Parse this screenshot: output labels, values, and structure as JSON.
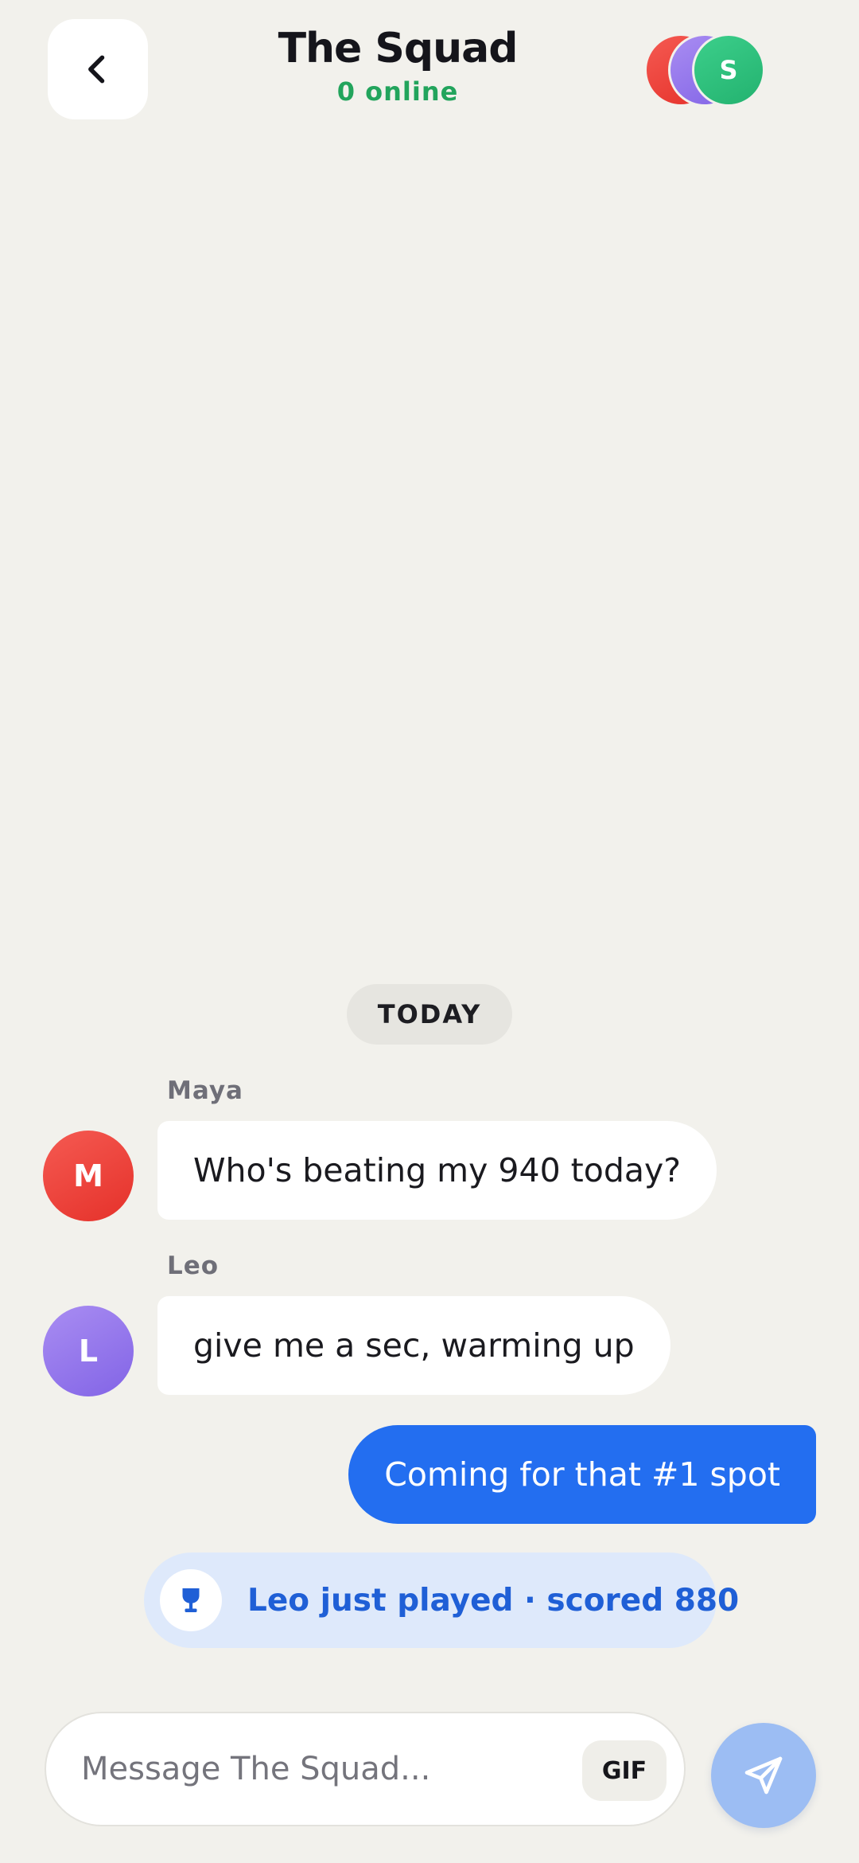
{
  "header": {
    "title": "The Squad",
    "status": "0 online",
    "member_initials": [
      "",
      "",
      "S"
    ]
  },
  "chat": {
    "date_separator": "TODAY",
    "messages": [
      {
        "sender": "Maya",
        "initial": "M",
        "text": "Who's beating my 940 today?",
        "direction": "incoming"
      },
      {
        "sender": "Leo",
        "initial": "L",
        "text": "give me a sec, warming up",
        "direction": "incoming"
      },
      {
        "sender": "",
        "initial": "",
        "text": "Coming for that #1 spot",
        "direction": "outgoing"
      }
    ],
    "event": {
      "text": "Leo just played · scored 880",
      "icon": "trophy-icon"
    }
  },
  "composer": {
    "placeholder": "Message The Squad...",
    "gif_label": "GIF",
    "send_icon": "send-icon"
  },
  "colors": {
    "background": "#F2F1EC",
    "online_green": "#22a45c",
    "outgoing_bubble": "#236EF0",
    "event_bg": "#DEE9FB",
    "event_text": "#1F5FD6",
    "send_button": "#9CBDF3",
    "avatar_maya": "#ef4a43",
    "avatar_leo": "#9277ea",
    "avatar_s": "#2ec07c"
  }
}
